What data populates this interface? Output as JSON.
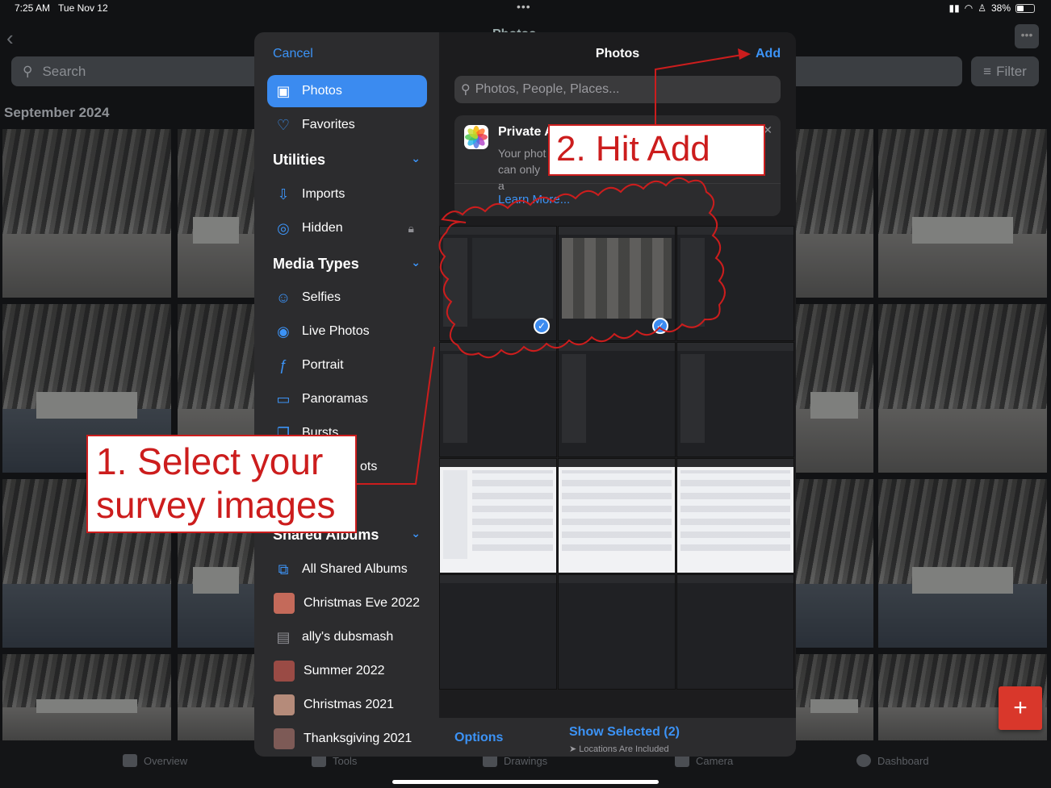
{
  "status_bar": {
    "time": "7:25 AM",
    "date": "Tue Nov 12",
    "battery": "38%",
    "battery_fraction": 0.38
  },
  "background": {
    "title": "Photos",
    "search_placeholder": "Search",
    "filter_label": "Filter",
    "section_heading": "September 2024",
    "tabs": [
      {
        "label": "Overview",
        "icon": "grid-icon"
      },
      {
        "label": "Tools",
        "icon": "toolbox-icon"
      },
      {
        "label": "Drawings",
        "icon": "drawing-icon"
      },
      {
        "label": "Camera",
        "icon": "camera-icon"
      },
      {
        "label": "Dashboard",
        "icon": "gauge-icon"
      }
    ],
    "fab_label": "+"
  },
  "picker": {
    "cancel": "Cancel",
    "title": "Photos",
    "add": "Add",
    "search_placeholder": "Photos, People, Places...",
    "privacy": {
      "title": "Private A",
      "body_line1": "Your phot",
      "body_line2": "can only a",
      "learn_more": "Learn More..."
    },
    "sidebar": {
      "photos": "Photos",
      "favorites": "Favorites",
      "utilities_heading": "Utilities",
      "imports": "Imports",
      "hidden": "Hidden",
      "media_types_heading": "Media Types",
      "selfies": "Selfies",
      "live_photos": "Live Photos",
      "portrait": "Portrait",
      "panoramas": "Panoramas",
      "bursts": "Bursts",
      "screenshots_partial": "ots",
      "shared_albums_heading": "Shared Albums",
      "albums": [
        {
          "label": "All Shared Albums",
          "thumb_color": ""
        },
        {
          "label": "Christmas Eve 2022",
          "thumb_color": "#c46a5a"
        },
        {
          "label": "ally's dubsmash",
          "thumb_color": ""
        },
        {
          "label": "Summer 2022",
          "thumb_color": "#9a4b45"
        },
        {
          "label": "Christmas 2021",
          "thumb_color": "#b58b7a"
        },
        {
          "label": "Thanksgiving 2021",
          "thumb_color": "#7d5a56"
        }
      ]
    },
    "footer": {
      "options": "Options",
      "show_selected": "Show Selected (2)",
      "locations": "Locations Are Included"
    }
  },
  "annotations": {
    "step1": {
      "line1": "1. Select your",
      "line2": "survey images"
    },
    "step2": "2. Hit Add",
    "color": "#cc1d1d"
  }
}
